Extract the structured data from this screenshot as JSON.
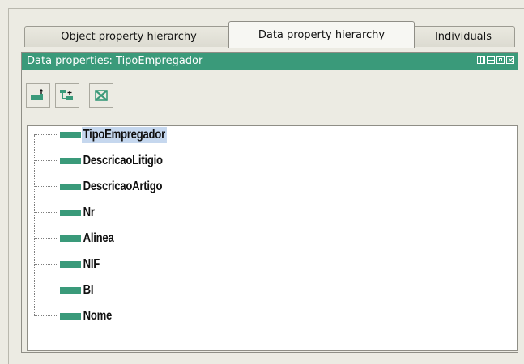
{
  "tabs": [
    {
      "label": "Object property hierarchy"
    },
    {
      "label": "Data property hierarchy"
    },
    {
      "label": "Individuals"
    }
  ],
  "panel": {
    "title": "Data properties: TipoEmpregador",
    "header_color": "#3a9a7a",
    "window_controls": [
      "split-vertical-icon",
      "split-horizontal-icon",
      "maximize-icon",
      "close-icon"
    ]
  },
  "toolbar": {
    "buttons": [
      {
        "icon": "add-subproperty-icon"
      },
      {
        "icon": "add-sibling-property-icon"
      },
      {
        "icon": "delete-property-icon"
      }
    ]
  },
  "tree": {
    "selected": "TipoEmpregador",
    "items": [
      {
        "label": "TipoEmpregador"
      },
      {
        "label": "DescricaoLitigio"
      },
      {
        "label": "DescricaoArtigo"
      },
      {
        "label": "Nr"
      },
      {
        "label": "Alinea"
      },
      {
        "label": "NIF"
      },
      {
        "label": "BI"
      },
      {
        "label": "Nome"
      }
    ]
  }
}
